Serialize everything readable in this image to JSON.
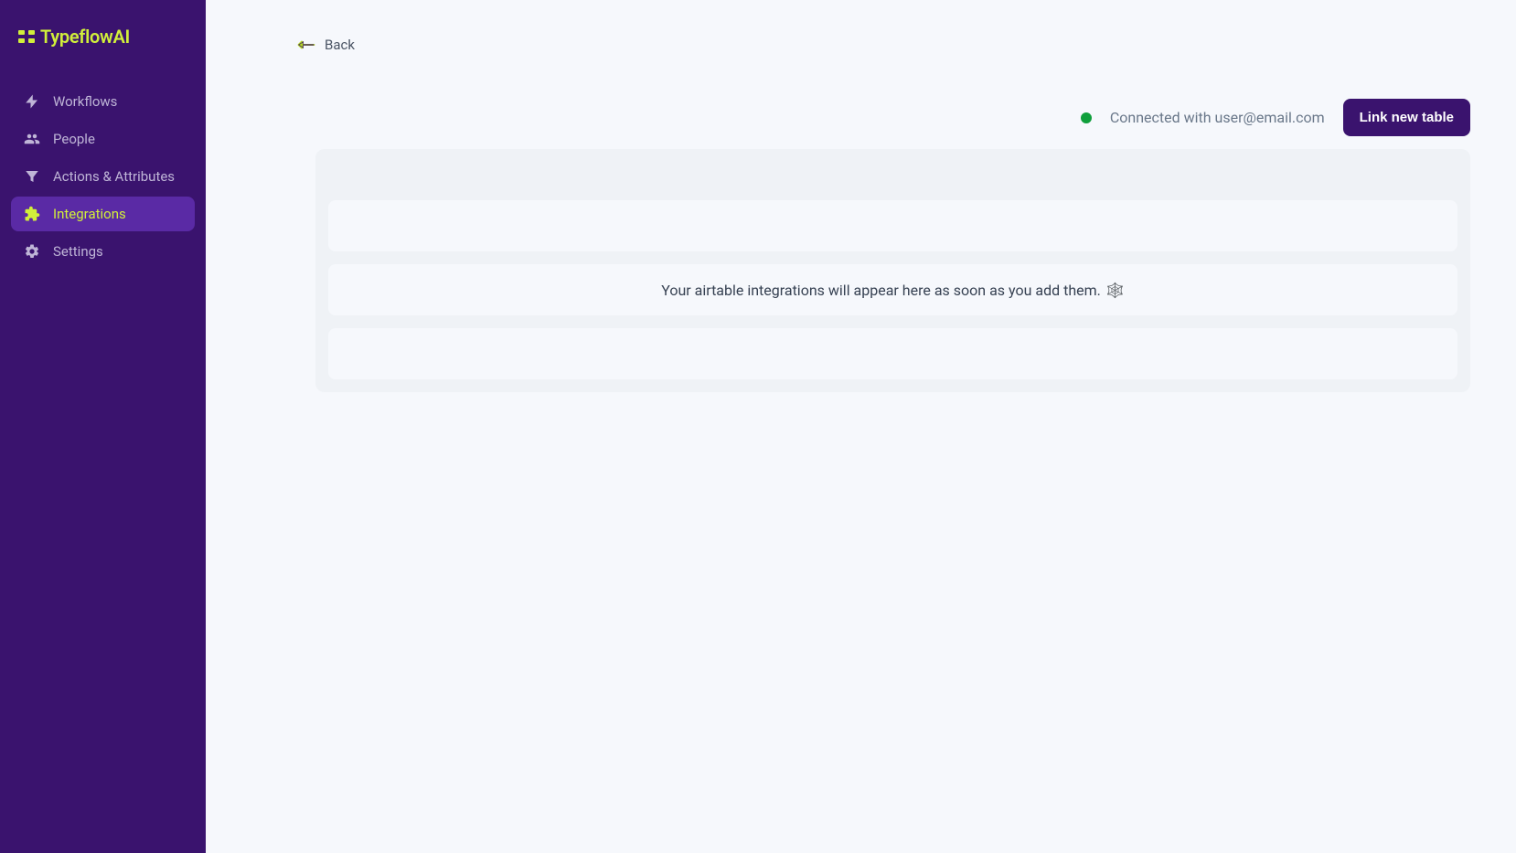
{
  "app": {
    "name": "TypeflowAI"
  },
  "sidebar": {
    "items": [
      {
        "label": "Workflows",
        "icon": "bolt-icon",
        "active": false
      },
      {
        "label": "People",
        "icon": "people-icon",
        "active": false
      },
      {
        "label": "Actions & Attributes",
        "icon": "filter-icon",
        "active": false
      },
      {
        "label": "Integrations",
        "icon": "puzzle-icon",
        "active": true
      },
      {
        "label": "Settings",
        "icon": "gear-icon",
        "active": false
      }
    ]
  },
  "header": {
    "back_label": "Back"
  },
  "status": {
    "text": "Connected with user@email.com",
    "color": "#0f9f3b"
  },
  "actions": {
    "link_table_label": "Link new table"
  },
  "content": {
    "empty_state_text": "Your airtable integrations will appear here as soon as you add them.",
    "empty_state_emoji": "🕸️"
  }
}
